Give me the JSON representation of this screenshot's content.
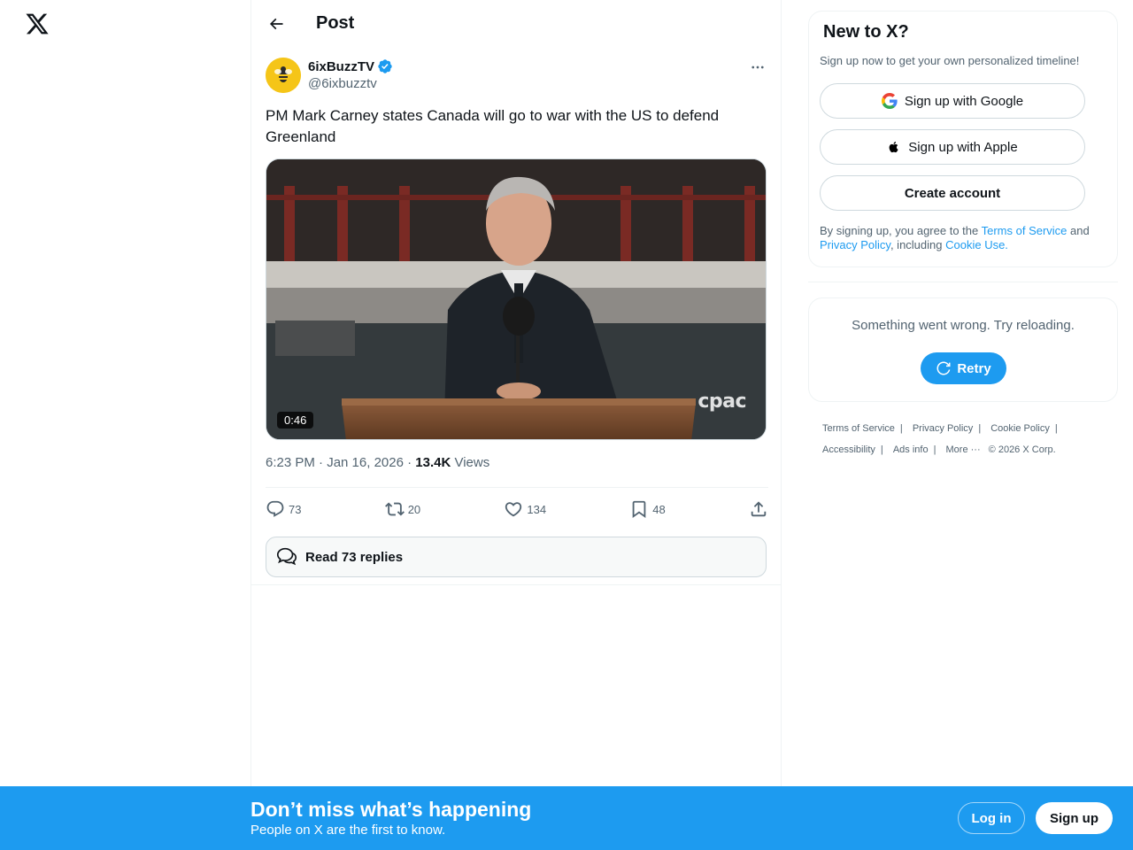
{
  "header": {
    "title": "Post"
  },
  "post": {
    "display_name": "6ixBuzzTV",
    "handle": "@6ixbuzztv",
    "text": "PM Mark Carney states Canada will go to war with the US to defend Greenland",
    "video_duration": "0:46",
    "video_watermark": "cpac",
    "timestamp": "6:23 PM · Jan 16, 2026",
    "views_count": "13.4K",
    "views_label": "Views",
    "separator": " · ",
    "actions": {
      "replies": "73",
      "reposts": "20",
      "likes": "134",
      "bookmarks": "48"
    },
    "read_replies_label": "Read 73 replies"
  },
  "signup": {
    "title": "New to X?",
    "subtitle": "Sign up now to get your own personalized timeline!",
    "google_label": "Sign up with Google",
    "apple_label": "Sign up with Apple",
    "create_label": "Create account",
    "terms_prefix": "By signing up, you agree to the ",
    "terms_link": "Terms of Service",
    "terms_and": " and ",
    "privacy_link": "Privacy Policy",
    "terms_including": ", including ",
    "cookie_link": "Cookie Use."
  },
  "error": {
    "message": "Something went wrong. Try reloading.",
    "retry_label": "Retry"
  },
  "footer": {
    "links": [
      "Terms of Service",
      "Privacy Policy",
      "Cookie Policy",
      "Accessibility",
      "Ads info",
      "More ···"
    ],
    "copyright": "© 2026 X Corp."
  },
  "banner": {
    "title": "Don’t miss what’s happening",
    "subtitle": "People on X are the first to know.",
    "login_label": "Log in",
    "signup_label": "Sign up"
  },
  "colors": {
    "accent": "#1d9bf0",
    "text_primary": "#0f1419",
    "text_secondary": "#536471",
    "verified": "#1d9bf0"
  }
}
